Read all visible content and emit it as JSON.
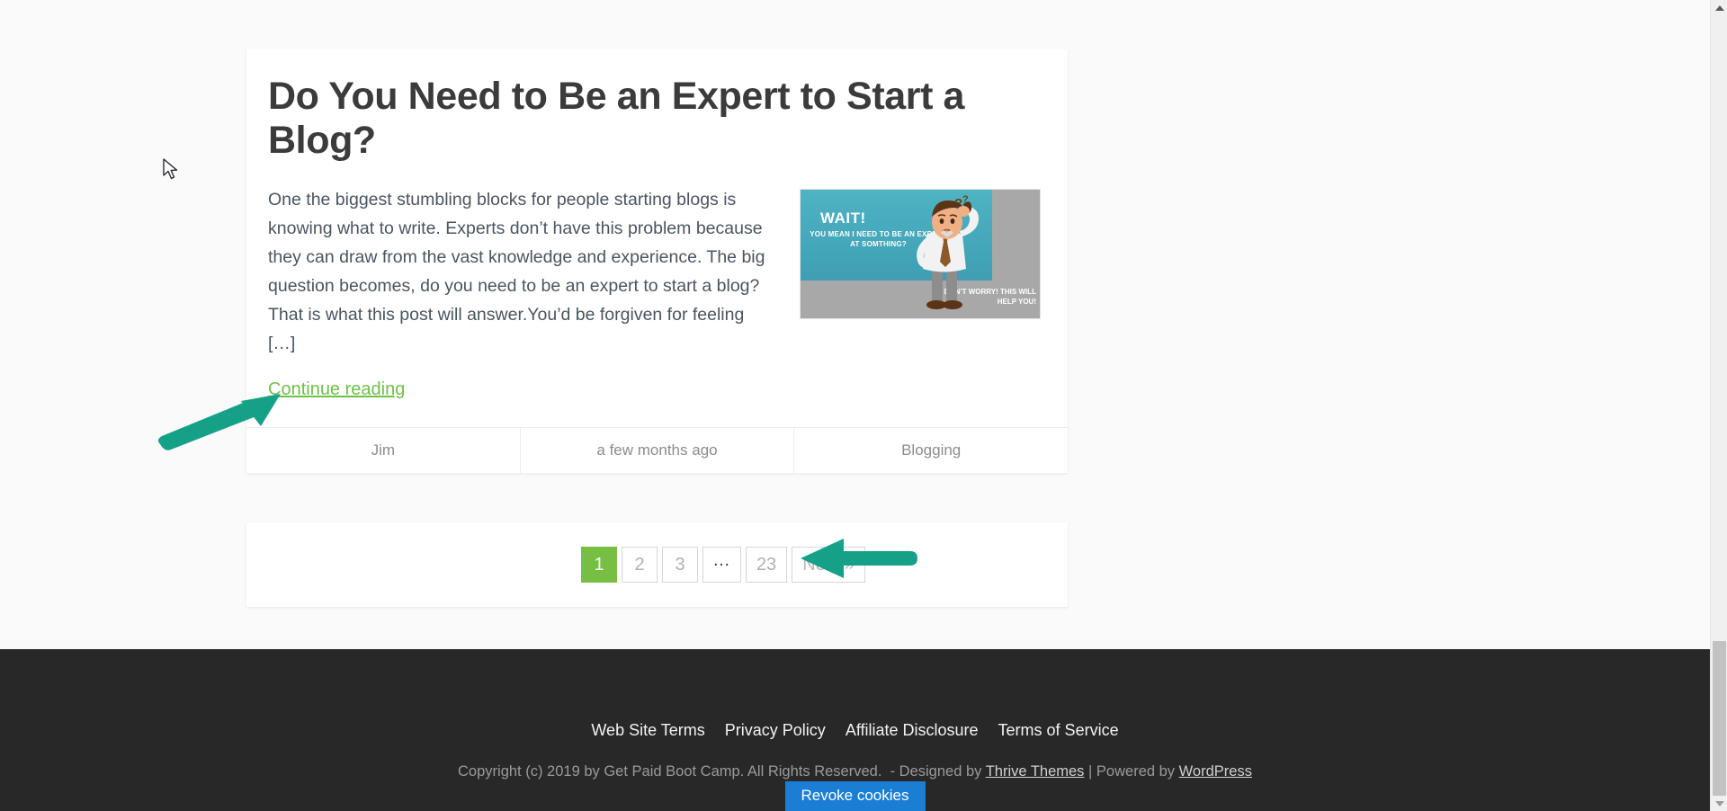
{
  "colors": {
    "page_background": "#fafafa",
    "card_background": "#ffffff",
    "link_green": "#6fc04a",
    "pagination_active": "#76bf43",
    "footer_background": "#282828",
    "annotation_arrow": "#15a188",
    "revoke_button": "#1a7fd4",
    "thumbnail_sky": "#4fb3c4"
  },
  "post": {
    "title": "Do You Need to Be an Expert to Start a Blog?",
    "excerpt": "One the biggest stumbling blocks for people starting blogs is knowing what to write. Experts don’t have this problem because they can draw from the vast knowledge and experience. The big question becomes, do you need to be an expert to start a blog? That is what this post will answer.You’d be forgiven for feeling […]",
    "continue_label": "Continue reading",
    "thumbnail": {
      "icon": "blog-post-thumbnail",
      "headline": "WAIT!",
      "subline": "YOU MEAN I NEED TO BE AN EXPERT AT SOMTHING?",
      "helpline": "DON’T WORRY! THIS WILL HELP YOU!"
    },
    "meta": [
      {
        "label": "Jim",
        "name": "author"
      },
      {
        "label": "a few months ago",
        "name": "date"
      },
      {
        "label": "Blogging",
        "name": "category"
      }
    ]
  },
  "pagination": {
    "pages": [
      {
        "label": "1",
        "active": true,
        "kind": "page"
      },
      {
        "label": "2",
        "active": false,
        "kind": "page"
      },
      {
        "label": "3",
        "active": false,
        "kind": "page"
      },
      {
        "label": "...",
        "active": false,
        "kind": "dots"
      },
      {
        "label": "23",
        "active": false,
        "kind": "page"
      },
      {
        "label": "Next »",
        "active": false,
        "kind": "next"
      }
    ]
  },
  "footer": {
    "nav": [
      "Web Site Terms",
      "Privacy Policy",
      "Affiliate Disclosure",
      "Terms of Service"
    ],
    "copyright_prefix": "Copyright (c) 2019 by Get Paid Boot Camp. All Rights Reserved.",
    "copyright_separator": "-",
    "designed_by_label": "Designed by",
    "designer": "Thrive Themes",
    "pipe": "|",
    "powered_by_label": "Powered by",
    "platform": "WordPress",
    "revoke_cookies_label": "Revoke cookies"
  },
  "annotations": [
    {
      "name": "arrow-to-continue-reading",
      "direction": "up-right"
    },
    {
      "name": "arrow-to-next-page",
      "direction": "left"
    }
  ],
  "scrollbar": {
    "up_icon": "chevron-up-icon",
    "down_icon": "chevron-down-icon"
  },
  "cursor": {
    "icon": "mouse-pointer-icon"
  }
}
